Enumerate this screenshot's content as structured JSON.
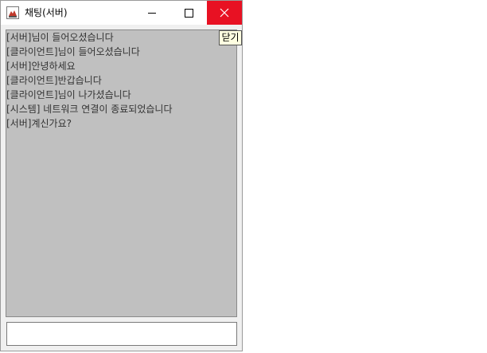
{
  "window": {
    "title": "채팅(서버)",
    "close_color": "#e81123"
  },
  "icons": {
    "app": "java-app-icon",
    "minimize": "minimize-icon",
    "maximize": "maximize-icon",
    "close": "close-icon"
  },
  "chat": {
    "background": "#c0c0c0",
    "messages": [
      "[서버]님이 들어오셨습니다",
      "[클라이언트]님이 들어오셨습니다",
      "[서버]안녕하세요",
      "[클라이언트]반갑습니다",
      "[클라이언트]님이 나가셨습니다",
      "[시스템] 네트워크 연결이 종료되었습니다",
      "[서버]계신가요?"
    ]
  },
  "input": {
    "value": ""
  },
  "tooltip": {
    "text": "닫기"
  }
}
